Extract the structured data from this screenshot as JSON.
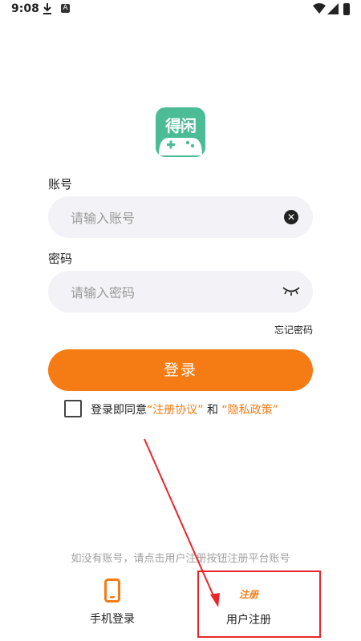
{
  "status_bar": {
    "time": "9:08",
    "notif_letter": "A"
  },
  "logo": {
    "text": "得闲"
  },
  "account": {
    "label": "账号",
    "placeholder": "请输入账号"
  },
  "password": {
    "label": "密码",
    "placeholder": "请输入密码"
  },
  "forgot_password": "忘记密码",
  "login_button": "登录",
  "agreement": {
    "prefix": "登录即同意",
    "terms": "“注册协议”",
    "connector": "和",
    "privacy": "“隐私政策”"
  },
  "hint": "如没有账号，请点击用户注册按钮注册平台账号",
  "bottom": {
    "phone_login": "手机登录",
    "register_tag": "注册",
    "user_register": "用户注册"
  },
  "colors": {
    "accent": "#f57c15",
    "logo_bg": "#4bbc96",
    "annotation": "#e8262a"
  }
}
